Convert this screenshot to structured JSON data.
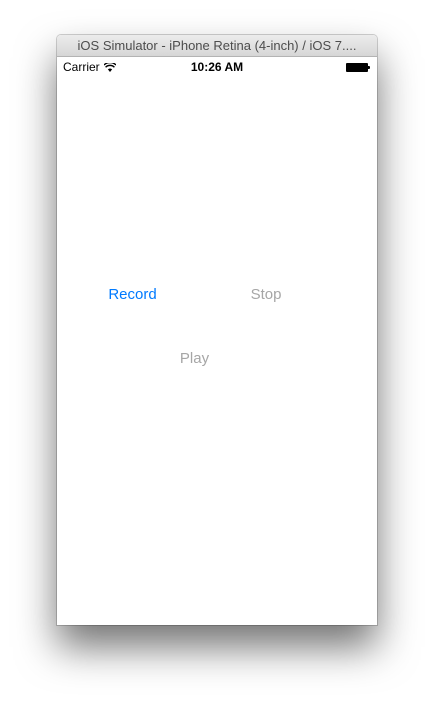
{
  "window": {
    "title": "iOS Simulator - iPhone Retina (4-inch) / iOS 7...."
  },
  "statusbar": {
    "carrier": "Carrier",
    "time": "10:26 AM",
    "icons": [
      "wifi-icon",
      "battery-icon"
    ]
  },
  "buttons": {
    "record": "Record",
    "stop": "Stop",
    "play": "Play"
  },
  "colors": {
    "accent": "#007aff",
    "disabled": "#a6a6a6"
  }
}
